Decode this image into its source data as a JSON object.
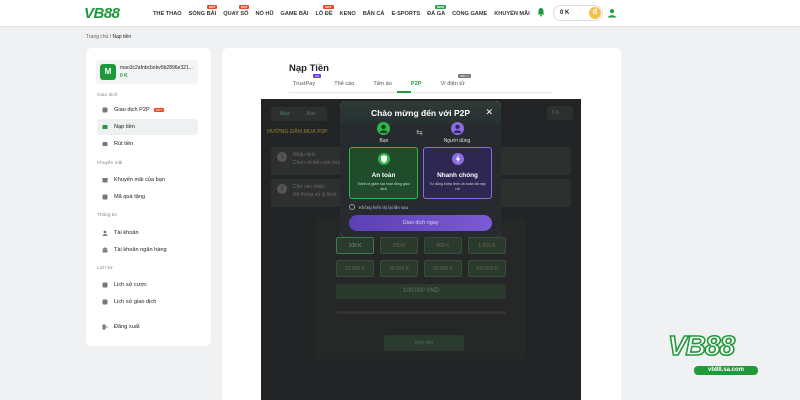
{
  "header": {
    "logo": "VB88",
    "nav": [
      {
        "label": "THỂ THAO",
        "tag": ""
      },
      {
        "label": "SÒNG BÀI",
        "tag": "HOT"
      },
      {
        "label": "QUAY SỐ",
        "tag": "HOT"
      },
      {
        "label": "NỔ HŨ",
        "tag": ""
      },
      {
        "label": "GAME BÀI",
        "tag": ""
      },
      {
        "label": "LÔ ĐỀ",
        "tag": "HOT"
      },
      {
        "label": "KENO",
        "tag": ""
      },
      {
        "label": "BẮN CÁ",
        "tag": ""
      },
      {
        "label": "E-SPORTS",
        "tag": ""
      },
      {
        "label": "ĐÁ GÀ",
        "tag": "NEW"
      },
      {
        "label": "CỔNG GAME",
        "tag": ""
      },
      {
        "label": "KHUYẾN MÃI",
        "tag": ""
      }
    ],
    "balance": "0 K",
    "icons": {
      "bell": "bell-icon",
      "coin": "coin-icon",
      "user": "user-icon"
    },
    "accent": "#1f9a3a"
  },
  "breadcrumb": {
    "home": "Trang chủ",
    "sep": "/",
    "current": "Nạp tiền"
  },
  "sidebar": {
    "account": {
      "initial": "M",
      "name": "mao3c2afnbcbobv5b2896e321...",
      "balance": "0 K"
    },
    "sections": [
      {
        "title": "Giao dịch",
        "items": [
          {
            "label": "Giao dịch P2P",
            "tag": "HOT",
            "icon": "p2p-icon"
          },
          {
            "label": "Nạp tiền",
            "tag": "",
            "icon": "wallet-icon"
          },
          {
            "label": "Rút tiền",
            "tag": "",
            "icon": "withdraw-icon"
          }
        ]
      },
      {
        "title": "Khuyến mãi",
        "items": [
          {
            "label": "Khuyến mãi của bạn",
            "tag": "",
            "icon": "gift-icon"
          },
          {
            "label": "Mã quà tặng",
            "tag": "",
            "icon": "code-icon"
          }
        ]
      },
      {
        "title": "Thông tin",
        "items": [
          {
            "label": "Tài khoản",
            "tag": "",
            "icon": "account-icon"
          },
          {
            "label": "Tài khoản ngân hàng",
            "tag": "",
            "icon": "bank-icon"
          }
        ]
      },
      {
        "title": "Lịch sử",
        "items": [
          {
            "label": "Lịch sử cược",
            "tag": "",
            "icon": "bet-history-icon"
          },
          {
            "label": "Lịch sử giao dịch",
            "tag": "",
            "icon": "transaction-history-icon"
          }
        ]
      }
    ],
    "logout": "Đăng xuất"
  },
  "main": {
    "title": "Nạp Tiền",
    "tabs": [
      {
        "label": "TrustPay",
        "badge": "Hot"
      },
      {
        "label": "Thẻ cào",
        "badge": ""
      },
      {
        "label": "Tiền ảo",
        "badge": ""
      },
      {
        "label": "P2P",
        "badge": ""
      },
      {
        "label": "Ví điện tử",
        "badge": "Bảo trì"
      }
    ],
    "selected_tab": "P2P",
    "behind": {
      "buy": "Mua",
      "sell": "Bán",
      "guide": "HƯỚNG DẪN MUA P2P",
      "step1_title": "Nhập lệnh",
      "step1_desc": "Chọn số tiền cần mua",
      "step2_title": "Chờ xác nhận",
      "step2_desc": "Hệ thống xử lý lệnh",
      "amounts": [
        "100 K",
        "200 K",
        "500 K",
        "1.000 K",
        "10.000 K",
        "20.000 K",
        "50.000 K",
        "100.000 K"
      ],
      "total": "100,000 VND",
      "balance_right": "0 K",
      "submit": "Nạp tiền"
    }
  },
  "modal": {
    "title": "Chào mừng đến với P2P",
    "you": "Bạn",
    "user": "Người dùng",
    "card_left": {
      "title": "An toàn",
      "desc": "Tránh bị giám sát hoạt động giao dịch"
    },
    "card_right": {
      "title": "Nhanh chóng",
      "desc": "Tự động khớp lệnh và hoàn tất nạp rút"
    },
    "dont_show": "Không hiển thị lại lần sau",
    "cta": "Giao dịch ngay"
  },
  "brand": {
    "logo": "VB88",
    "url": "vb88.sa.com"
  }
}
